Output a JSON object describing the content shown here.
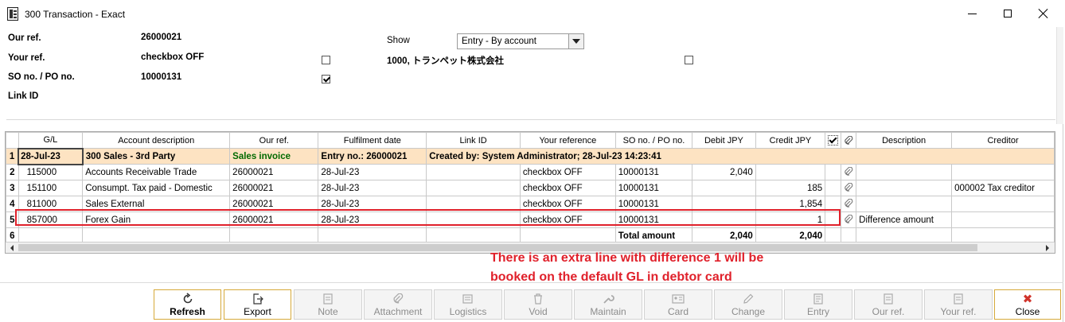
{
  "window": {
    "title": "300 Transaction - Exact"
  },
  "header": {
    "our_ref_label": "Our ref.",
    "our_ref_value": "26000021",
    "your_ref_label": "Your ref.",
    "your_ref_value": "checkbox OFF",
    "so_po_label": "SO no. / PO no.",
    "so_po_value": "10000131",
    "link_id_label": "Link ID",
    "show_label": "Show",
    "show_value": "Entry - By account",
    "account_text": "1000, トランペット株式会社"
  },
  "grid": {
    "columns": [
      "G/L",
      "Account description",
      "Our ref.",
      "Fulfilment date",
      "Link ID",
      "Your reference",
      "SO no. / PO no.",
      "Debit JPY",
      "Credit JPY",
      "Description",
      "Creditor"
    ],
    "header_row": {
      "num": "1",
      "date": "28-Jul-23",
      "desc": "300 Sales - 3rd Party",
      "ref": "Sales invoice",
      "entry": "Entry no.: 26000021",
      "created": "Created by: System Administrator; 28-Jul-23 14:23:41"
    },
    "rows": [
      {
        "num": "2",
        "gl": "115000",
        "desc": "Accounts Receivable Trade",
        "ref": "26000021",
        "date": "28-Jul-23",
        "link": "",
        "your_ref": "checkbox OFF",
        "so": "10000131",
        "debit": "2,040",
        "credit": "",
        "description": "",
        "creditor": ""
      },
      {
        "num": "3",
        "gl": "151100",
        "desc": "Consumpt. Tax paid - Domestic",
        "ref": "26000021",
        "date": "28-Jul-23",
        "link": "",
        "your_ref": "checkbox OFF",
        "so": "10000131",
        "debit": "",
        "credit": "185",
        "description": "",
        "creditor": "000002 Tax creditor"
      },
      {
        "num": "4",
        "gl": "811000",
        "desc": "Sales External",
        "ref": "26000021",
        "date": "28-Jul-23",
        "link": "",
        "your_ref": "checkbox OFF",
        "so": "10000131",
        "debit": "",
        "credit": "1,854",
        "description": "",
        "creditor": ""
      },
      {
        "num": "5",
        "gl": "857000",
        "desc": "Forex Gain",
        "ref": "26000021",
        "date": "28-Jul-23",
        "link": "",
        "your_ref": "checkbox OFF",
        "so": "10000131",
        "debit": "",
        "credit": "1",
        "description": "Difference amount",
        "creditor": ""
      }
    ],
    "total_row": {
      "num": "6",
      "label": "Total amount",
      "debit": "2,040",
      "credit": "2,040"
    }
  },
  "annotation": {
    "line1": "There is an extra line with difference 1 will be",
    "line2": "booked on the default GL in debtor card",
    "color": "#e0212b"
  },
  "toolbar": {
    "buttons": [
      {
        "label": "Refresh",
        "icon": "refresh-icon",
        "enabled": true
      },
      {
        "label": "Export",
        "icon": "export-icon",
        "enabled": true
      },
      {
        "label": "Note",
        "icon": "note-icon",
        "enabled": false
      },
      {
        "label": "Attachment",
        "icon": "paperclip-icon",
        "enabled": false
      },
      {
        "label": "Logistics",
        "icon": "logistics-icon",
        "enabled": false
      },
      {
        "label": "Void",
        "icon": "trash-icon",
        "enabled": false
      },
      {
        "label": "Maintain",
        "icon": "wrench-icon",
        "enabled": false
      },
      {
        "label": "Card",
        "icon": "card-icon",
        "enabled": false
      },
      {
        "label": "Change",
        "icon": "pencil-icon",
        "enabled": false
      },
      {
        "label": "Entry",
        "icon": "entry-icon",
        "enabled": false
      },
      {
        "label": "Our ref.",
        "icon": "our-ref-icon",
        "enabled": false
      },
      {
        "label": "Your ref.",
        "icon": "your-ref-icon",
        "enabled": false
      },
      {
        "label": "Close",
        "icon": "close-icon",
        "enabled": true
      }
    ]
  }
}
